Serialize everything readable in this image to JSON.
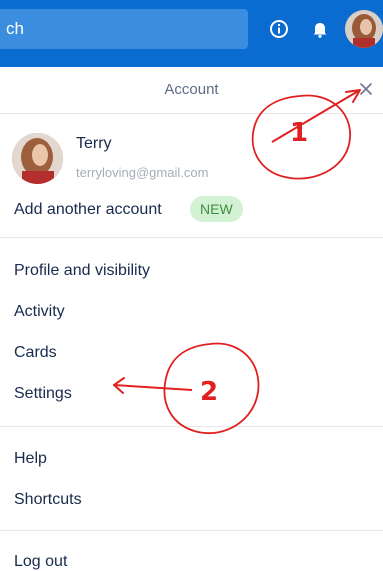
{
  "topbar": {
    "search_text": "ch",
    "info_icon": "info-icon",
    "notification_icon": "bell-icon",
    "avatar": "user-avatar"
  },
  "panel": {
    "title": "Account",
    "close_icon": "close-icon",
    "user": {
      "name": "Terry",
      "email": "terryloving@gmail.com"
    },
    "add_account": {
      "label": "Add another account",
      "badge": "NEW"
    },
    "menu_group_1": [
      "Profile and visibility",
      "Activity",
      "Cards",
      "Settings"
    ],
    "menu_group_2": [
      "Help",
      "Shortcuts"
    ],
    "logout": "Log out"
  },
  "annotations": {
    "step_1": "1",
    "step_2": "2"
  },
  "colors": {
    "topbar": "#0a6bd1",
    "search": "#3b8ddf",
    "badge_bg": "#d3f1d3",
    "badge_text": "#3e8e41",
    "annotation": "#e02020"
  }
}
